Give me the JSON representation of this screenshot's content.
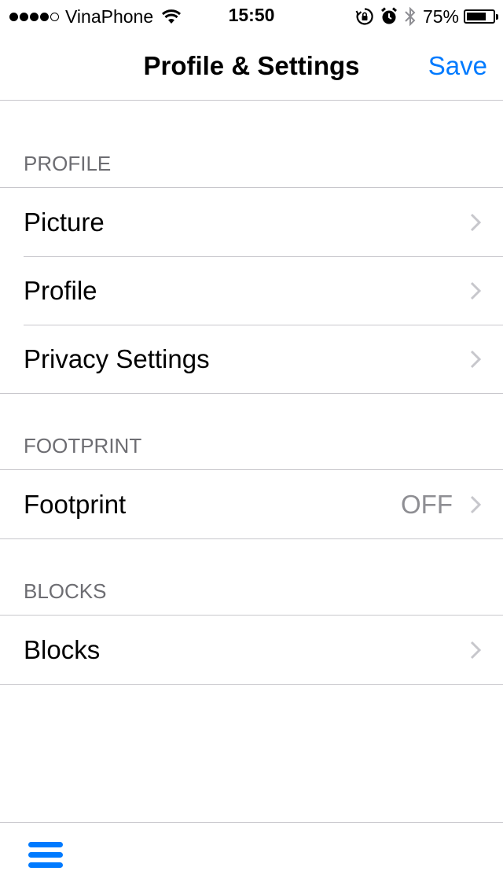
{
  "status_bar": {
    "carrier": "VinaPhone",
    "time": "15:50",
    "battery_percent": "75%",
    "battery_level": 0.75,
    "signal_bars_filled": 4,
    "signal_bars_total": 5,
    "icons": [
      "wifi-icon",
      "rotation-lock-icon",
      "alarm-icon",
      "bluetooth-icon",
      "battery-icon"
    ]
  },
  "nav": {
    "title": "Profile & Settings",
    "save_label": "Save"
  },
  "sections": {
    "profile": {
      "header": "PROFILE",
      "items": [
        {
          "label": "Picture"
        },
        {
          "label": "Profile"
        },
        {
          "label": "Privacy Settings"
        }
      ]
    },
    "footprint": {
      "header": "FOOTPRINT",
      "items": [
        {
          "label": "Footprint",
          "value": "OFF"
        }
      ]
    },
    "blocks": {
      "header": "BLOCKS",
      "items": [
        {
          "label": "Blocks"
        }
      ]
    }
  },
  "toolbar": {
    "menu_icon": "hamburger-menu-icon"
  },
  "colors": {
    "accent": "#007aff",
    "separator": "#c8c7cc",
    "section_header_text": "#6d6d72",
    "secondary_value_text": "#8e8e93",
    "chevron": "#c7c7cc"
  }
}
